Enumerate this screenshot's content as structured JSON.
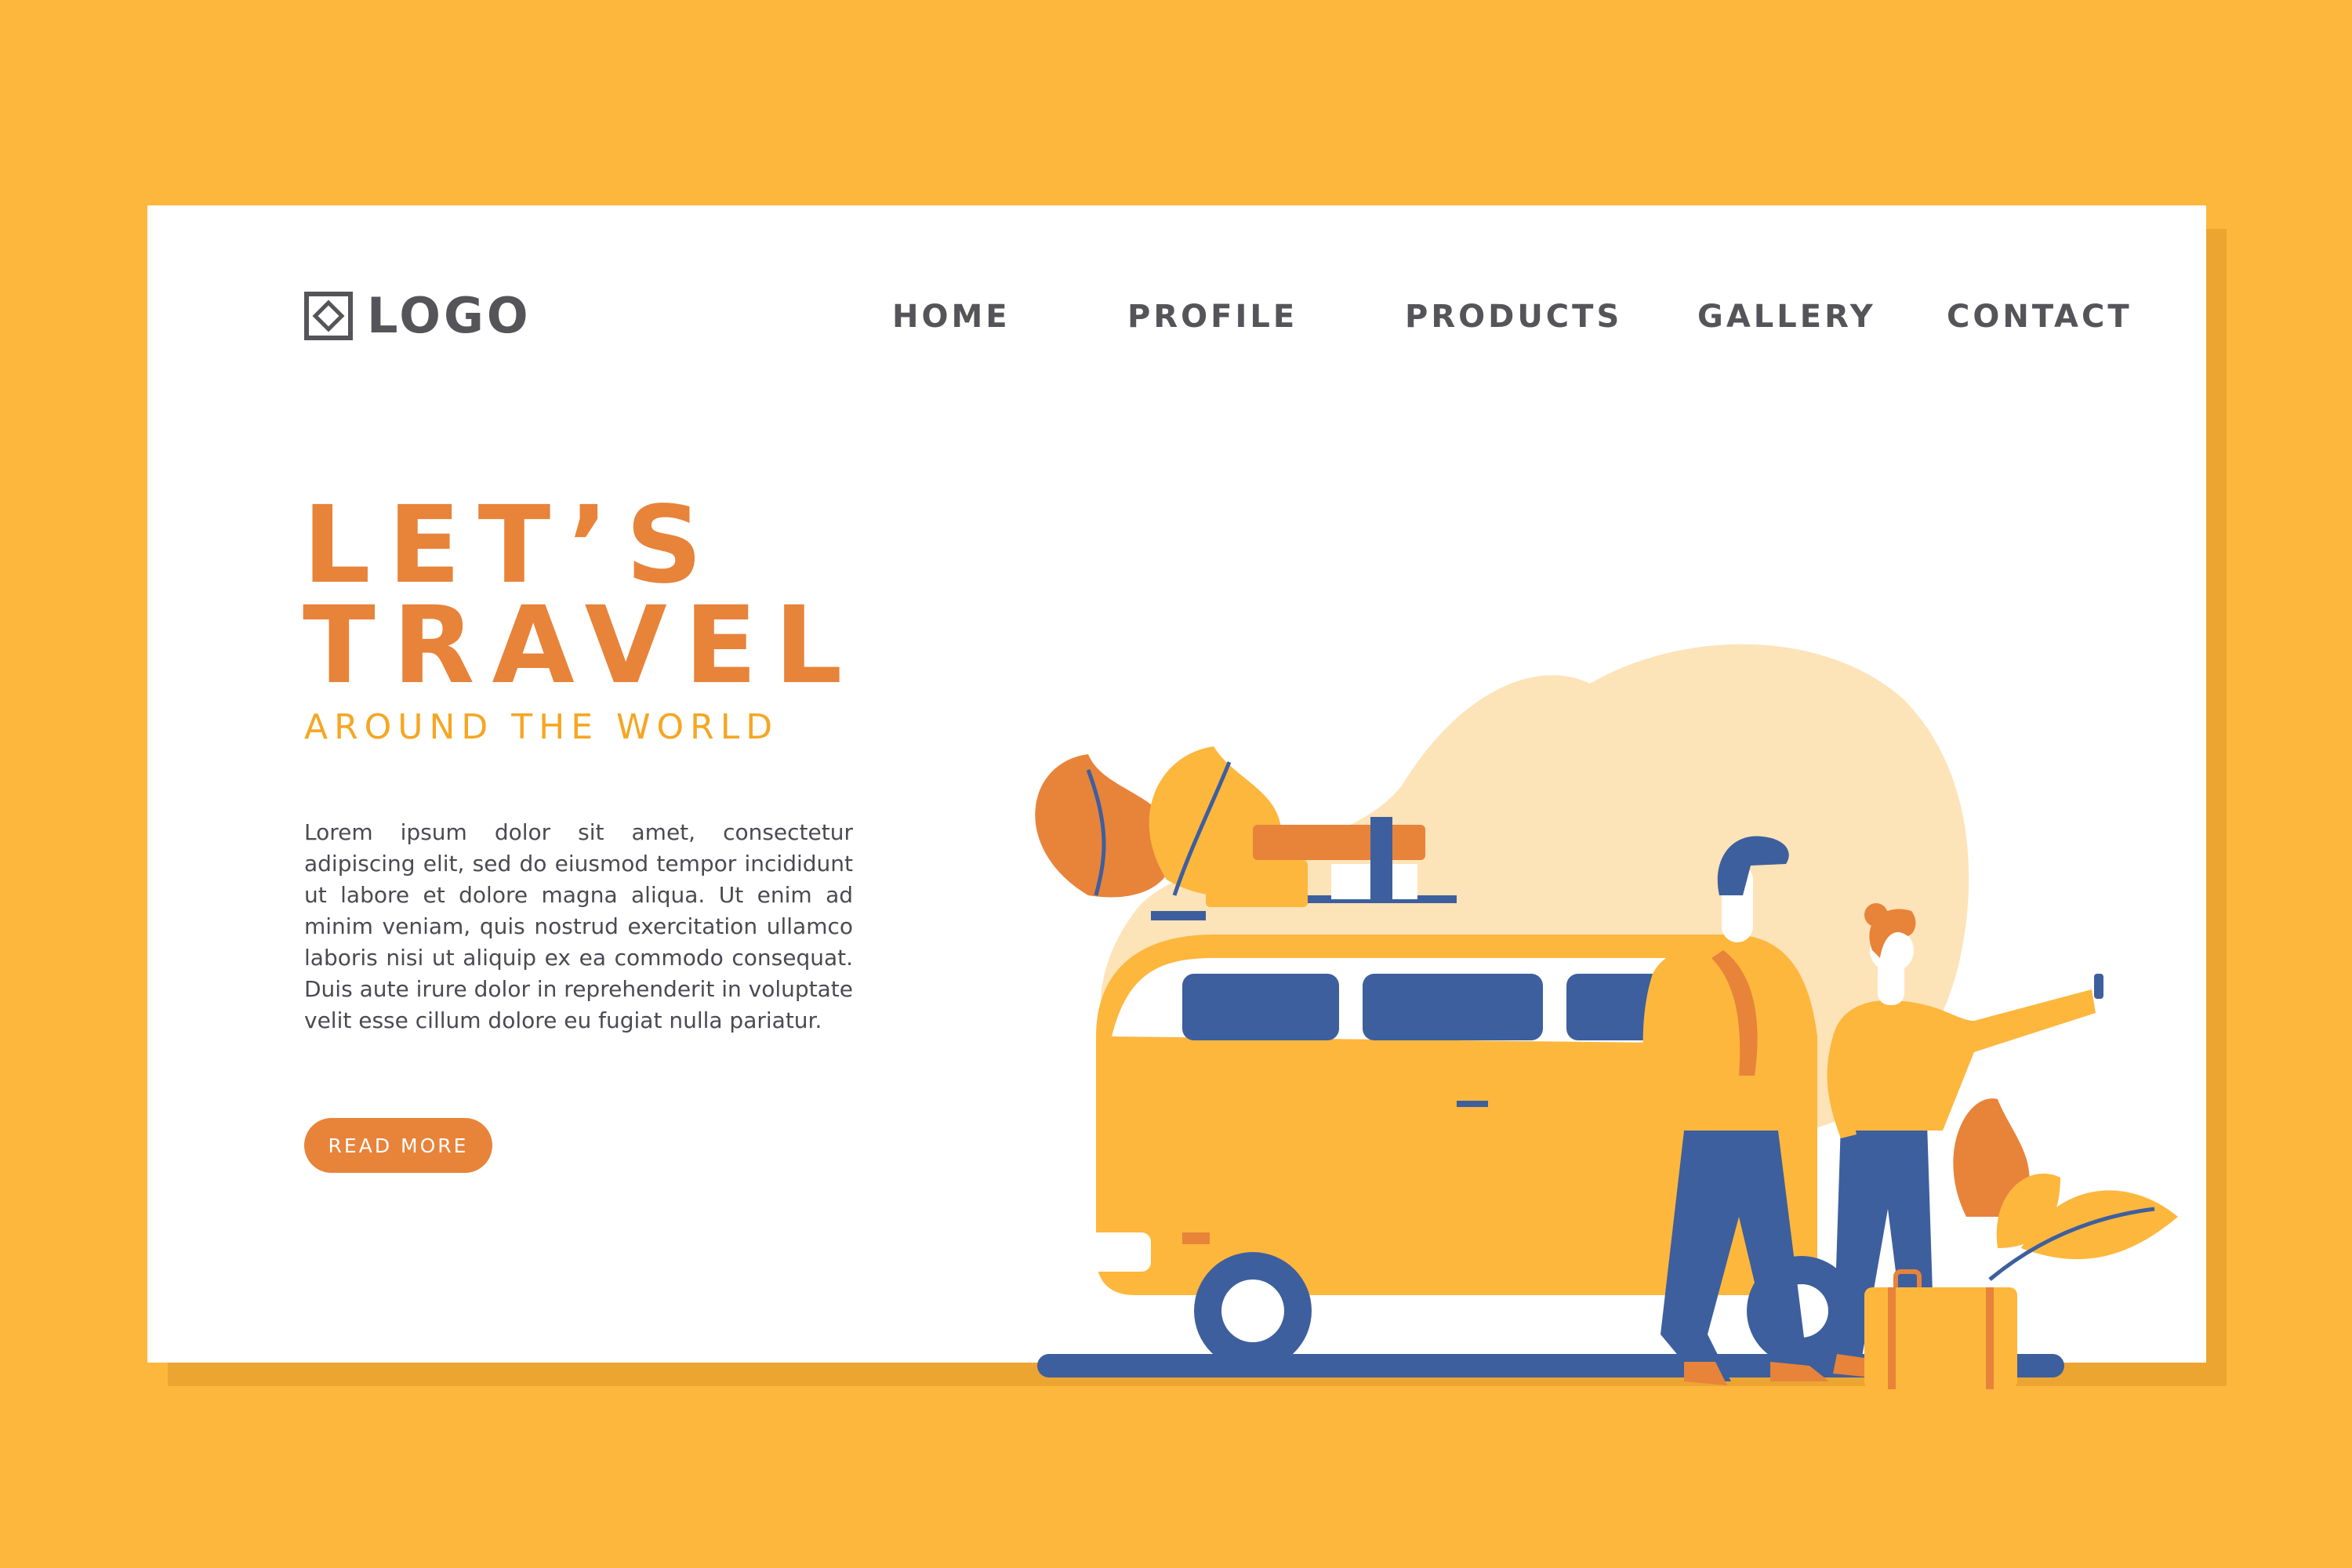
{
  "brand": {
    "logo_text": "LOGO"
  },
  "nav": {
    "items": [
      {
        "label": "HOME"
      },
      {
        "label": "PROFILE"
      },
      {
        "label": "PRODUCTS"
      },
      {
        "label": "GALLERY"
      },
      {
        "label": "CONTACT"
      }
    ]
  },
  "hero": {
    "headline_line1": "LET’S",
    "headline_line2": "TRAVEL",
    "subheadline": "AROUND THE WORLD",
    "body": "Lorem ipsum dolor sit amet, consectetur adipiscing elit, sed do eiusmod tempor incididunt ut labore et dolore magna aliqua. Ut enim ad minim veniam, quis nostrud exercitation ullamco laboris nisi ut aliquip ex ea commodo consequat. Duis aute irure dolor in reprehenderit in voluptate velit esse cillum dolore eu fugiat nulla pariatur.",
    "cta_label": "READ MORE"
  },
  "colors": {
    "background": "#FDB73D",
    "accent_orange": "#E8833A",
    "accent_yellow": "#F5A623",
    "navy": "#3D5F9E",
    "blob": "#FDE3B8",
    "text_gray": "#555559"
  }
}
